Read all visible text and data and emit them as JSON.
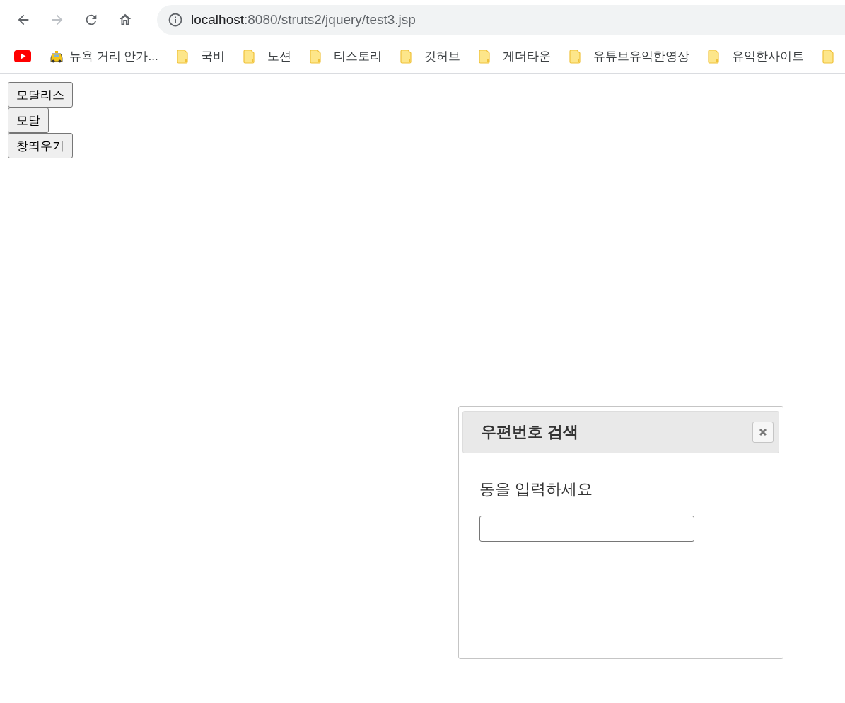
{
  "browser": {
    "url_host": "localhost",
    "url_rest": ":8080/struts2/jquery/test3.jsp",
    "forward_disabled": true
  },
  "bookmarks": [
    {
      "kind": "youtube"
    },
    {
      "kind": "taxi",
      "label": "뉴욕 거리 안가..."
    },
    {
      "kind": "folder",
      "label": "국비"
    },
    {
      "kind": "folder",
      "label": "노션"
    },
    {
      "kind": "folder",
      "label": "티스토리"
    },
    {
      "kind": "folder",
      "label": "깃허브"
    },
    {
      "kind": "folder",
      "label": "게더타운"
    },
    {
      "kind": "folder",
      "label": "유튜브유익한영상"
    },
    {
      "kind": "folder",
      "label": "유익한사이트"
    }
  ],
  "buttons": [
    "모달리스",
    "모달",
    "창띄우기"
  ],
  "dialog": {
    "title": "우편번호 검색",
    "prompt": "동을 입력하세요"
  }
}
